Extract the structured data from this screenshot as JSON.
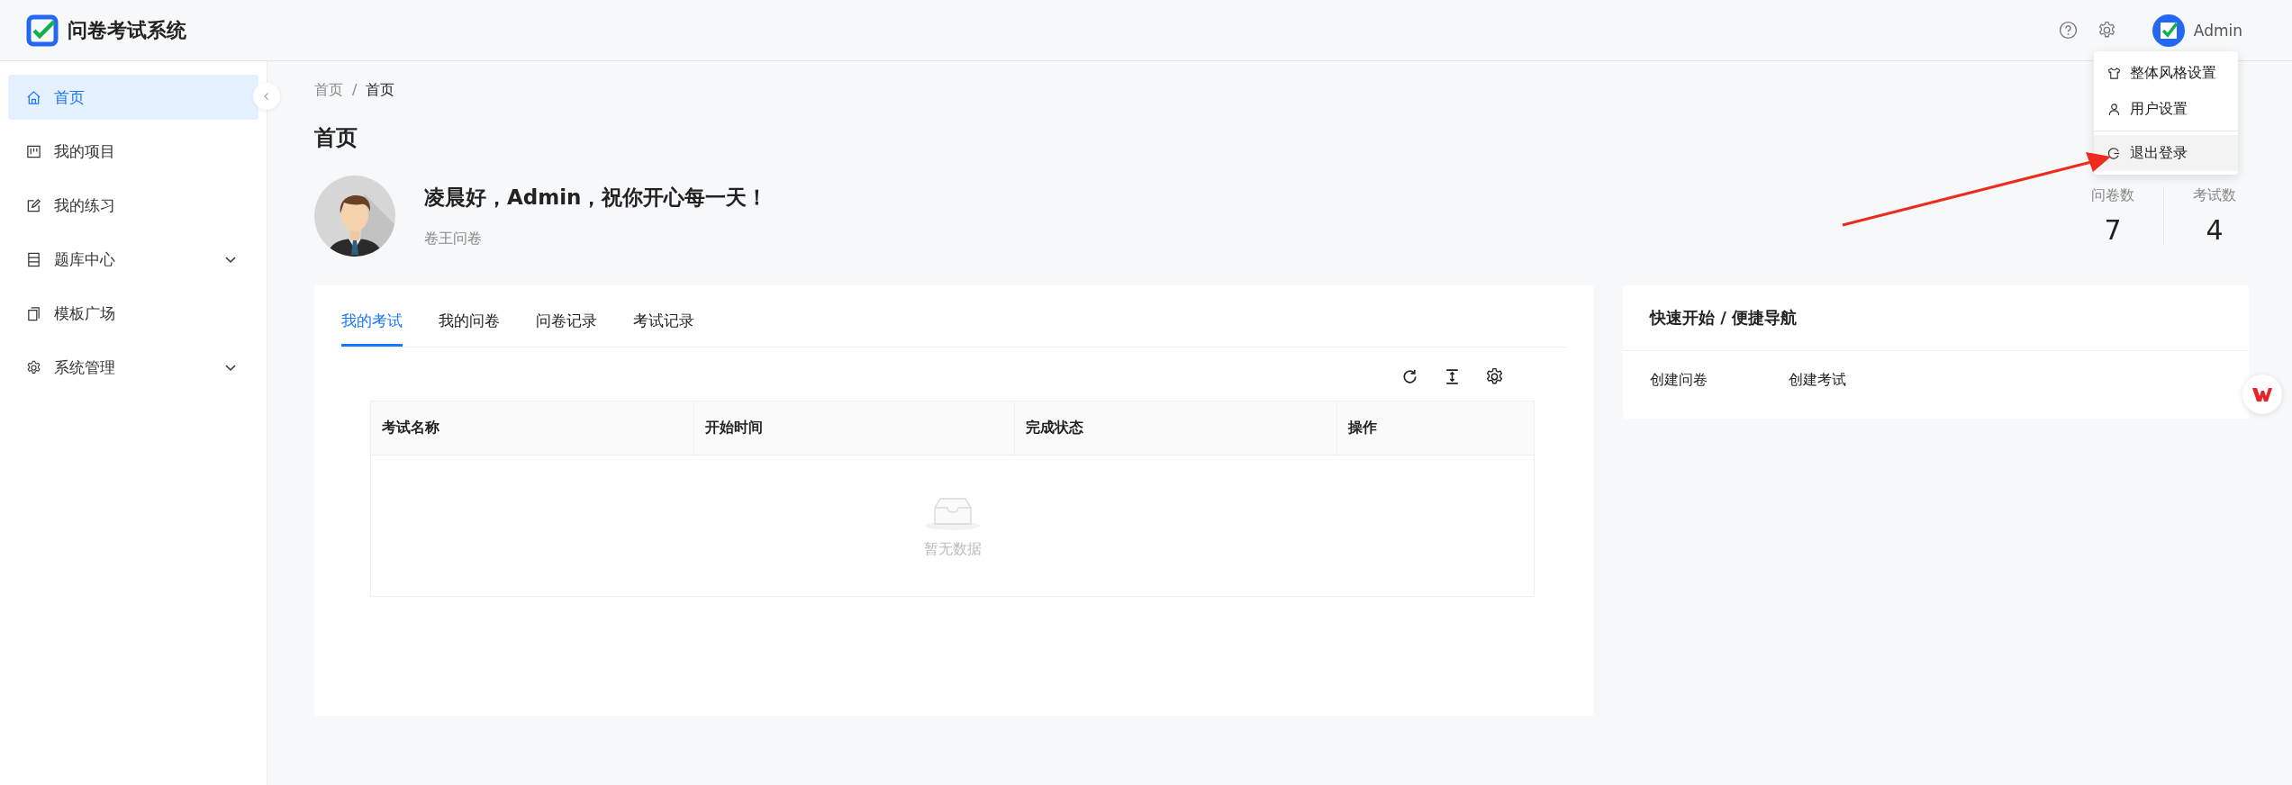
{
  "header": {
    "title": "问卷考试系统",
    "user": "Admin"
  },
  "user_menu": [
    {
      "label": "整体风格设置",
      "kind": "theme",
      "selected": false
    },
    {
      "label": "用户设置",
      "kind": "user",
      "selected": false
    },
    {
      "label": "退出登录",
      "kind": "logout",
      "selected": true
    }
  ],
  "sidebar": {
    "items": [
      {
        "label": "首页",
        "selected": true
      },
      {
        "label": "我的项目",
        "selected": false
      },
      {
        "label": "我的练习",
        "selected": false
      },
      {
        "label": "题库中心",
        "selected": false,
        "expanded": false
      },
      {
        "label": "模板广场",
        "selected": false
      },
      {
        "label": "系统管理",
        "selected": false,
        "expanded": false
      }
    ]
  },
  "breadcrumb": [
    "首页",
    "首页"
  ],
  "breadcrumb_separator": "/",
  "page_title": "首页",
  "welcome": {
    "greeting": "凌晨好，Admin，祝你开心每一天！",
    "subtitle": "卷王问卷"
  },
  "stats": [
    {
      "label": "问卷数",
      "value": "7"
    },
    {
      "label": "考试数",
      "value": "4"
    }
  ],
  "tabs": [
    {
      "label": "我的考试",
      "selected": true
    },
    {
      "label": "我的问卷",
      "selected": false
    },
    {
      "label": "问卷记录",
      "selected": false
    },
    {
      "label": "考试记录",
      "selected": false
    }
  ],
  "table": {
    "columns": [
      "考试名称",
      "开始时间",
      "完成状态",
      "操作"
    ],
    "empty_text": "暂无数据"
  },
  "quick_nav": {
    "title": "快速开始 / 便捷导航",
    "links": [
      "创建问卷",
      "创建考试"
    ]
  }
}
